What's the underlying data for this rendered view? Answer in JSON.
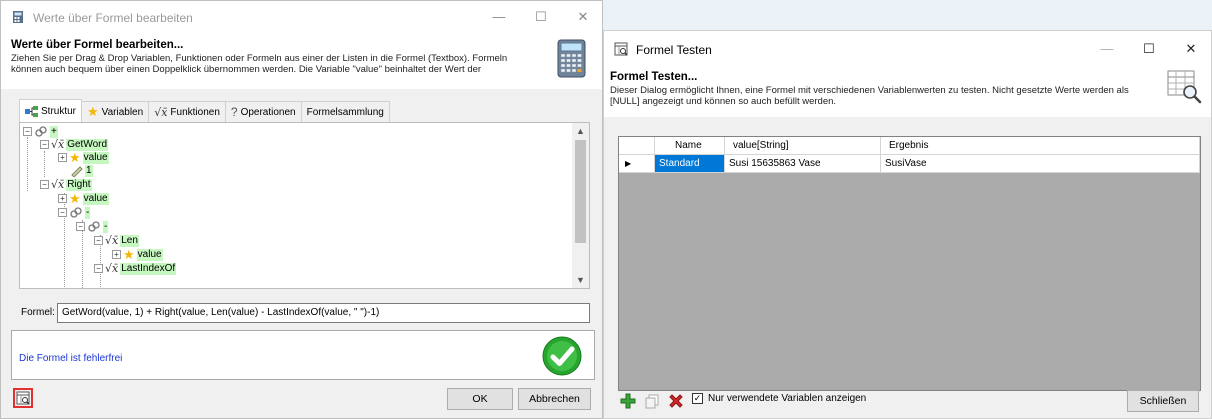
{
  "editor_window": {
    "title": "Werte über Formel bearbeiten",
    "header_title": "Werte über Formel bearbeiten...",
    "header_desc_1": "Ziehen Sie per Drag & Drop Variablen, Funktionen oder Formeln aus einer der Listen in die Formel (Textbox). Formeln",
    "header_desc_2": "können auch bequem über einen Doppelklick übernommen werden. Die Variable \"value\" beinhaltet der Wert der",
    "tabs": [
      "Struktur",
      "Variablen",
      "Funktionen",
      "Operationen",
      "Formelsammlung"
    ],
    "tree": {
      "n1": "+",
      "n2": "GetWord",
      "n3": "value",
      "n4": "1",
      "n5": "Right",
      "n6": "value",
      "n7": "-",
      "n8": "-",
      "n9": "Len",
      "n10": "value",
      "n11": "LastIndexOf"
    },
    "formula_label": "Formel:",
    "formula_value": "GetWord(value, 1) + Right(value, Len(value) - LastIndexOf(value, \" \")-1)",
    "status_text": "Die Formel ist fehlerfrei",
    "ok_label": "OK",
    "cancel_label": "Abbrechen"
  },
  "test_window": {
    "title": "Formel Testen",
    "header_title": "Formel Testen...",
    "header_desc_1": "Dieser Dialog ermöglicht Ihnen, eine Formel mit verschiedenen Variablenwerten zu testen. Nicht gesetzte Werte werden als",
    "header_desc_2": "[NULL] angezeigt und können so auch befüllt werden.",
    "columns": [
      "Name",
      "value[String]",
      "Ergebnis"
    ],
    "rows": [
      {
        "name": "Standard",
        "value": "Susi 15635863 Vase",
        "result": "SusiVase"
      }
    ],
    "checkbox_label": "Nur verwendete Variablen anzeigen",
    "checkbox_checked": true,
    "close_label": "Schließen"
  },
  "colors": {
    "selection": "#0078d7",
    "tree_highlight": "#c6f7c0",
    "status_text": "#1a35d4",
    "highlight_border": "#e03030"
  }
}
